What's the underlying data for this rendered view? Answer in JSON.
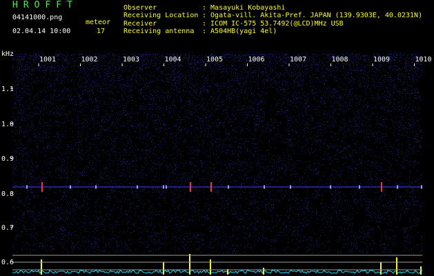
{
  "header": {
    "brand": "HROFFT",
    "filename": "04141000.png",
    "datetime": "02.04.14 10:00",
    "count_label": "meteor",
    "count_value": "17",
    "observer_label": "Observer",
    "observer_value": ": Masayuki Kobayashi",
    "location_label": "Receiving Location",
    "location_value": ": Ogata-vill. Akita-Pref. JAPAN (139.9303E, 40.0231N)",
    "receiver_label": "Receiver",
    "receiver_value": ": ICOM IC-575 53.7492(@LCD)MHz USB",
    "antenna_label": "Receiving antenna",
    "antenna_value": ": A504HB(yagi 4el)"
  },
  "spectrogram": {
    "y_unit": "kHz",
    "y_ticks": [
      "1.1",
      "1.0",
      "0.9",
      "0.8",
      "0.7",
      "0.6"
    ],
    "x_ticks": [
      "1001",
      "1002",
      "1003",
      "1004",
      "1005",
      "1006",
      "1007",
      "1008",
      "1009",
      "1010"
    ],
    "colors": {
      "background": "#000000",
      "noise": "#1a1aa0",
      "text_white": "#ffffff",
      "text_yellow": "#ffff00",
      "brand_green": "#33ff33",
      "meteor_red": "#ff3030",
      "level_cyan": "#00e0ff",
      "level_yellow": "#ffff00"
    }
  }
}
